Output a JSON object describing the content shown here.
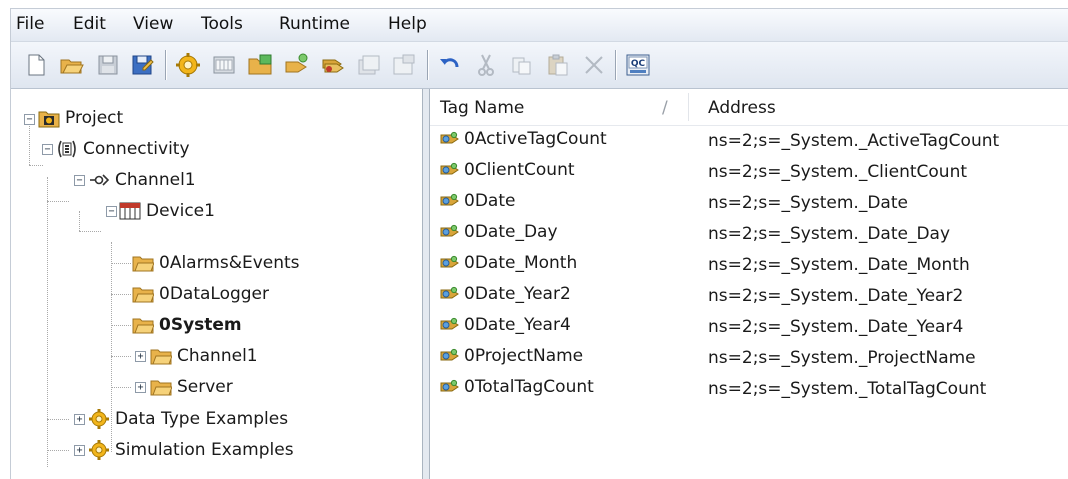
{
  "menu": [
    "File",
    "Edit",
    "View",
    "Tools",
    "Runtime",
    "Help"
  ],
  "toolbar": {
    "buttons": [
      "new-icon",
      "open-icon",
      "save-icon",
      "save-as-icon",
      "new-channel-icon",
      "new-device-icon",
      "new-tag-group-icon",
      "new-tag-icon",
      "bulk-tags-icon",
      "duplicate-icon",
      "properties-icon",
      "undo-icon",
      "cut-icon",
      "copy-icon",
      "paste-icon",
      "delete-icon",
      "quick-client-icon"
    ],
    "quick_client_label": "QC"
  },
  "tree": {
    "project": "Project",
    "connectivity": "Connectivity",
    "channel": "Channel1",
    "device": "Device1",
    "folders": [
      "0Alarms&Events",
      "0DataLogger",
      "0System",
      "Channel1",
      "Server"
    ],
    "data_type_examples": "Data Type Examples",
    "simulation_examples": "Simulation Examples"
  },
  "list": {
    "columns": [
      "Tag Name",
      "Address"
    ],
    "sort_indicator": "/",
    "rows": [
      {
        "name": "0ActiveTagCount",
        "address": "ns=2;s=_System._ActiveTagCount"
      },
      {
        "name": "0ClientCount",
        "address": "ns=2;s=_System._ClientCount"
      },
      {
        "name": "0Date",
        "address": "ns=2;s=_System._Date"
      },
      {
        "name": "0Date_Day",
        "address": "ns=2;s=_System._Date_Day"
      },
      {
        "name": "0Date_Month",
        "address": "ns=2;s=_System._Date_Month"
      },
      {
        "name": "0Date_Year2",
        "address": "ns=2;s=_System._Date_Year2"
      },
      {
        "name": "0Date_Year4",
        "address": "ns=2;s=_System._Date_Year4"
      },
      {
        "name": "0ProjectName",
        "address": "ns=2;s=_System._ProjectName"
      },
      {
        "name": "0TotalTagCount",
        "address": "ns=2;s=_System._TotalTagCount"
      }
    ]
  },
  "colors": {
    "folder": "#e8b24a",
    "gear": "#f2b51b",
    "tag": "#d9a53a",
    "device_red": "#c0392b"
  }
}
